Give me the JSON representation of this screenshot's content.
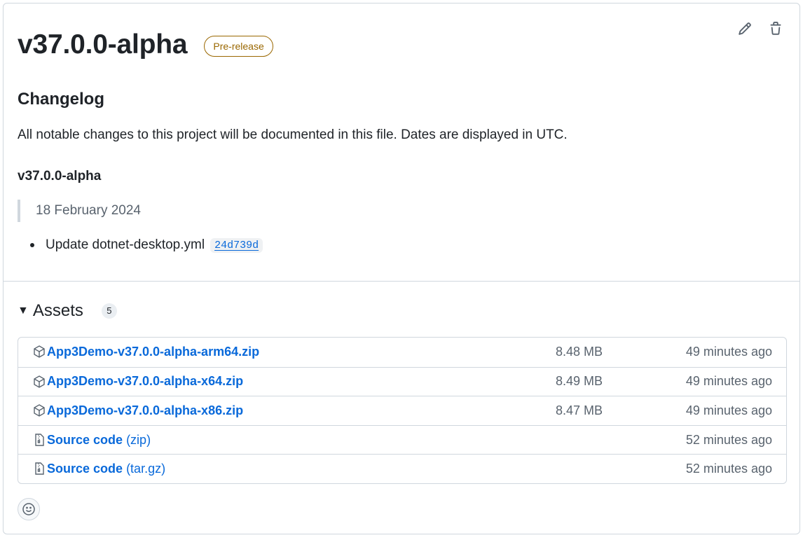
{
  "release": {
    "title": "v37.0.0-alpha",
    "badge": "Pre-release",
    "actions": {
      "edit_icon": "pencil-icon",
      "delete_icon": "trash-icon"
    }
  },
  "body": {
    "heading": "Changelog",
    "intro": "All notable changes to this project will be documented in this file. Dates are displayed in UTC.",
    "version_heading": "v37.0.0-alpha",
    "date": "18 February 2024",
    "changes": [
      {
        "text": "Update dotnet-desktop.yml",
        "sha": "24d739d"
      }
    ]
  },
  "assets": {
    "title": "Assets",
    "count": "5",
    "items": [
      {
        "icon": "package-icon",
        "name": "App3Demo-v37.0.0-alpha-arm64.zip",
        "suffix": "",
        "size": "8.48 MB",
        "time": "49 minutes ago"
      },
      {
        "icon": "package-icon",
        "name": "App3Demo-v37.0.0-alpha-x64.zip",
        "suffix": "",
        "size": "8.49 MB",
        "time": "49 minutes ago"
      },
      {
        "icon": "package-icon",
        "name": "App3Demo-v37.0.0-alpha-x86.zip",
        "suffix": "",
        "size": "8.47 MB",
        "time": "49 minutes ago"
      },
      {
        "icon": "file-zip-icon",
        "name": "Source code",
        "suffix": "(zip)",
        "size": "",
        "time": "52 minutes ago"
      },
      {
        "icon": "file-zip-icon",
        "name": "Source code",
        "suffix": "(tar.gz)",
        "size": "",
        "time": "52 minutes ago"
      }
    ]
  },
  "reactions": {
    "icon": "smiley-icon"
  },
  "colors": {
    "accent": "#0969da",
    "prerelease": "#9a6700",
    "border": "#d0d7de",
    "muted": "#59636e"
  }
}
